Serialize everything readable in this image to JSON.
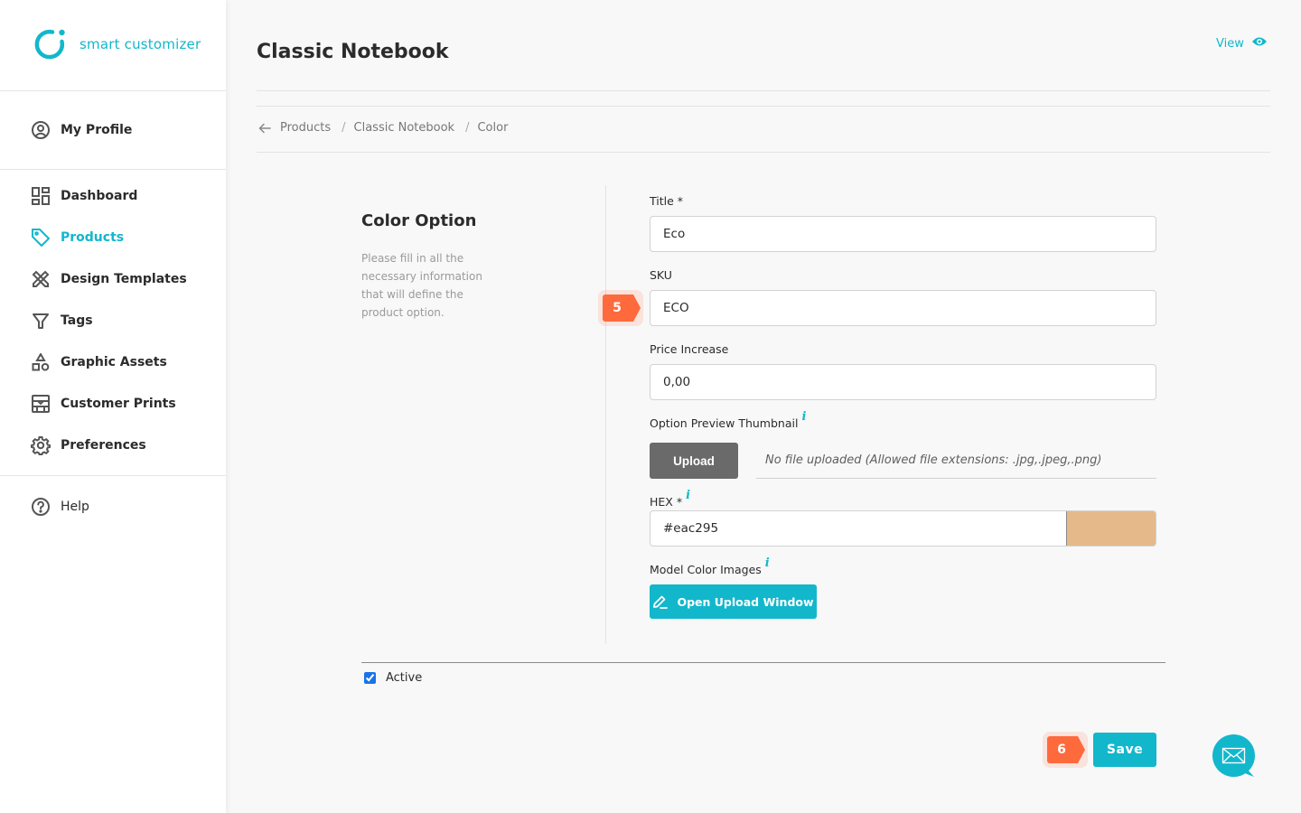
{
  "brand": {
    "name": "smart customizer",
    "accent": "#12b7cc"
  },
  "sidebar": {
    "profile": {
      "label": "My Profile",
      "icon": "user-circle-icon"
    },
    "items": [
      {
        "label": "Dashboard",
        "icon": "dashboard-icon",
        "active": false
      },
      {
        "label": "Products",
        "icon": "tag-icon",
        "active": true
      },
      {
        "label": "Design Templates",
        "icon": "design-tools-icon",
        "active": false
      },
      {
        "label": "Tags",
        "icon": "filter-icon",
        "active": false
      },
      {
        "label": "Graphic Assets",
        "icon": "shapes-icon",
        "active": false
      },
      {
        "label": "Customer Prints",
        "icon": "prints-icon",
        "active": false
      },
      {
        "label": "Preferences",
        "icon": "gear-icon",
        "active": false
      }
    ],
    "help": {
      "label": "Help",
      "icon": "help-circle-icon"
    }
  },
  "header": {
    "title": "Classic Notebook",
    "view_label": "View"
  },
  "breadcrumb": [
    "Products",
    "Classic Notebook",
    "Color"
  ],
  "section": {
    "title": "Color Option",
    "description": "Please fill in all the necessary information that will define the product option."
  },
  "form": {
    "title": {
      "label": "Title *",
      "value": "Eco"
    },
    "sku": {
      "label": "SKU",
      "value": "ECO"
    },
    "price_increase": {
      "label": "Price Increase",
      "value": "0,00"
    },
    "thumbnail": {
      "label": "Option Preview Thumbnail",
      "upload_label": "Upload",
      "status": "No file uploaded (Allowed file extensions: .jpg,.jpeg,.png)"
    },
    "hex": {
      "label": "HEX *",
      "value": "#eac295",
      "swatch": "#e5b98a"
    },
    "model_images": {
      "label": "Model Color Images",
      "button_label": "Open Upload Window"
    },
    "active": {
      "label": "Active",
      "checked": true
    },
    "save_label": "Save"
  },
  "steps": {
    "sku_step": "5",
    "save_step": "6"
  },
  "info_glyph": "i"
}
